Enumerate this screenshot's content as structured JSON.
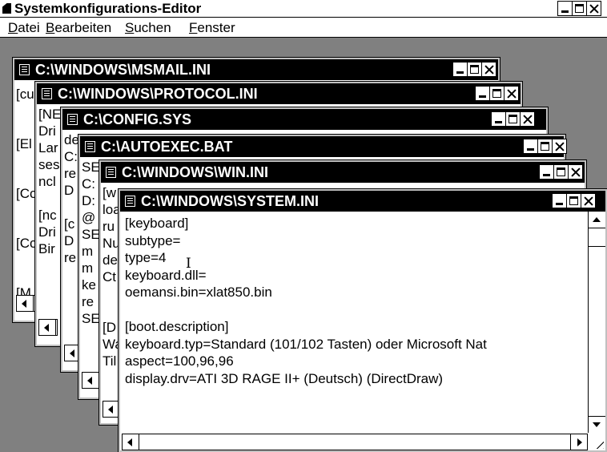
{
  "app": {
    "title": "Systemkonfigurations-Editor",
    "menu": [
      {
        "label": "Datei",
        "accel": "D",
        "rest": "atei"
      },
      {
        "label": "Bearbeiten",
        "accel": "B",
        "rest": "earbeiten"
      },
      {
        "label": "Suchen",
        "accel": "S",
        "rest": "uchen"
      },
      {
        "label": "Fenster",
        "accel": "F",
        "rest": "enster"
      }
    ]
  },
  "windows": [
    {
      "title": "C:\\WINDOWS\\MSMAIL.INI",
      "lines": [
        "[cu",
        "",
        "[El",
        "",
        "[Cc",
        "",
        "[Cc",
        "",
        "[M"
      ]
    },
    {
      "title": "C:\\WINDOWS\\PROTOCOL.INI",
      "lines": [
        "[NE",
        "Dri",
        "Lar",
        "ses",
        "ncl",
        "",
        "[nc",
        "Dri",
        "Bir"
      ]
    },
    {
      "title": "C:\\CONFIG.SYS",
      "lines": [
        "de",
        "C:",
        "re",
        "D",
        "",
        "[c",
        "D",
        "re"
      ]
    },
    {
      "title": "C:\\AUTOEXEC.BAT",
      "lines": [
        "SE",
        "C:",
        "D:",
        "@",
        "SE",
        "m",
        "m",
        "ke",
        "re",
        "SE"
      ]
    },
    {
      "title": "C:\\WINDOWS\\WIN.INI",
      "lines": [
        "[w",
        "loa",
        "ru",
        "Nu",
        "de",
        "Ct",
        "",
        "",
        "[D",
        "Wa",
        "Til"
      ]
    },
    {
      "title": "C:\\WINDOWS\\SYSTEM.INI",
      "lines": [
        "[keyboard]",
        "subtype=",
        "type=4",
        "keyboard.dll=",
        "oemansi.bin=xlat850.bin",
        "",
        "[boot.description]",
        "keyboard.typ=Standard (101/102 Tasten) oder Microsoft Nat",
        "aspect=100,96,96",
        "display.drv=ATI 3D RAGE II+ (Deutsch) (DirectDraw)"
      ]
    }
  ],
  "cursor_glyph": "I"
}
